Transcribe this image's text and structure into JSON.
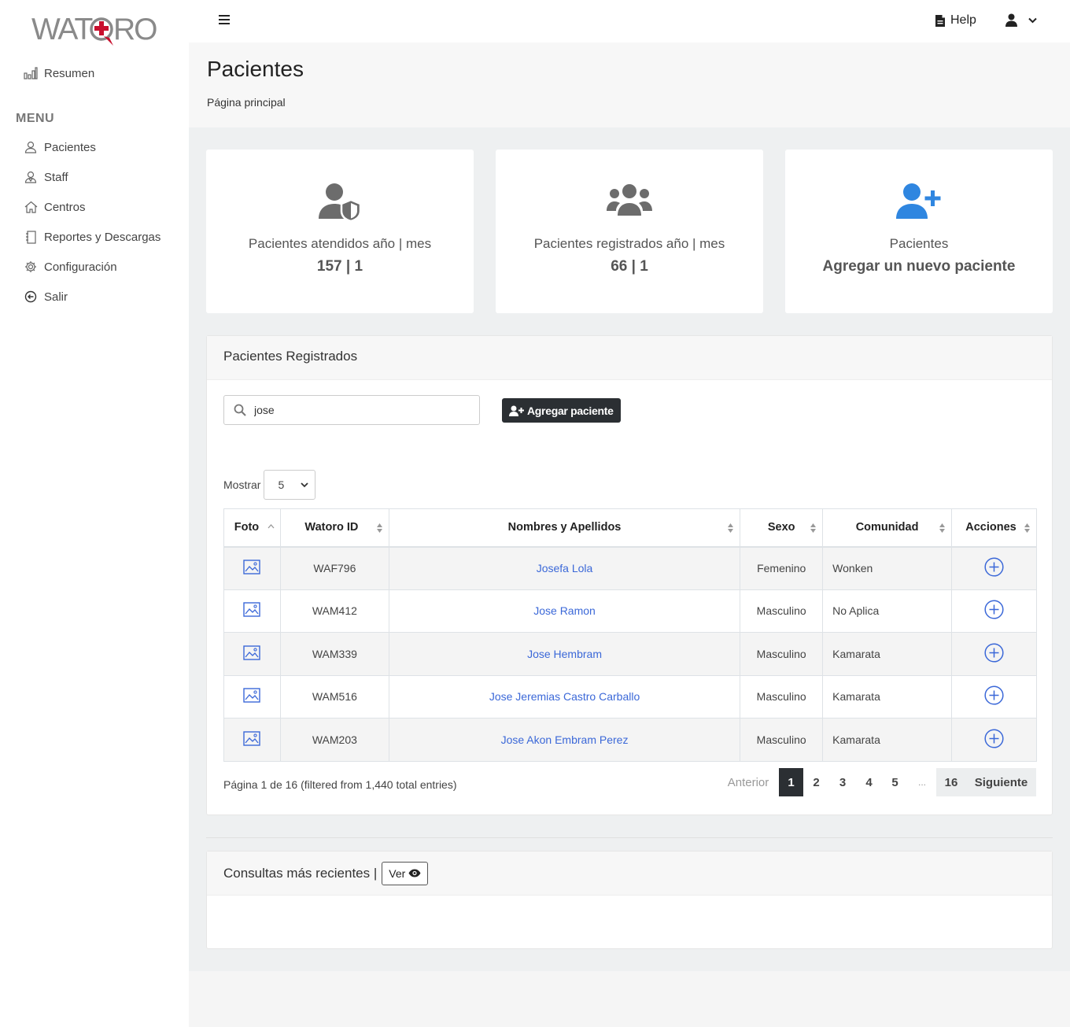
{
  "app": {
    "logo_text": "WATQRO"
  },
  "sidebar": {
    "resumen": "Resumen",
    "menu_heading": "MENU",
    "items": [
      {
        "label": "Pacientes",
        "icon": "user-icon"
      },
      {
        "label": "Staff",
        "icon": "staff-icon"
      },
      {
        "label": "Centros",
        "icon": "home-icon"
      },
      {
        "label": "Reportes y Descargas",
        "icon": "notebook-icon"
      },
      {
        "label": "Configuración",
        "icon": "gear-icon"
      },
      {
        "label": "Salir",
        "icon": "exit-icon"
      }
    ]
  },
  "topbar": {
    "help_label": "Help"
  },
  "page": {
    "title": "Pacientes",
    "breadcrumb": "Página principal"
  },
  "stats": [
    {
      "label": "Pacientes atendidos año | mes",
      "value": "157 | 1",
      "icon": "user-shield-icon"
    },
    {
      "label": "Pacientes registrados año | mes",
      "value": "66 | 1",
      "icon": "users-group-icon"
    },
    {
      "label": "Pacientes",
      "value": "Agregar un nuevo paciente",
      "icon": "user-plus-icon"
    }
  ],
  "patients_panel": {
    "title": "Pacientes Registrados",
    "search_value": "jose",
    "add_button": "Agregar paciente",
    "show_label": "Mostrar",
    "page_size": "5",
    "columns": [
      "Foto",
      "Watoro ID",
      "Nombres y Apellidos",
      "Sexo",
      "Comunidad",
      "Acciones"
    ],
    "rows": [
      {
        "id": "WAF796",
        "name": "Josefa Lola",
        "sex": "Femenino",
        "community": "Wonken"
      },
      {
        "id": "WAM412",
        "name": "Jose Ramon",
        "sex": "Masculino",
        "community": "No Aplica"
      },
      {
        "id": "WAM339",
        "name": "Jose Hembram",
        "sex": "Masculino",
        "community": "Kamarata"
      },
      {
        "id": "WAM516",
        "name": "Jose Jeremias Castro Carballo",
        "sex": "Masculino",
        "community": "Kamarata"
      },
      {
        "id": "WAM203",
        "name": "Jose Akon Embram Perez",
        "sex": "Masculino",
        "community": "Kamarata"
      }
    ],
    "page_info": "Página 1 de 16 (filtered from 1,440 total entries)",
    "pagination": {
      "prev": "Anterior",
      "pages": [
        "1",
        "2",
        "3",
        "4",
        "5"
      ],
      "ellipsis": "...",
      "last": "16",
      "next": "Siguiente",
      "current": "1"
    }
  },
  "recent_panel": {
    "title": "Consultas más recientes |",
    "view_button": "Ver"
  },
  "colors": {
    "accent_blue": "#3b68d8",
    "icon_blue": "#2f86e0",
    "dark": "#2b2f33",
    "logo_red": "#c8102e"
  }
}
